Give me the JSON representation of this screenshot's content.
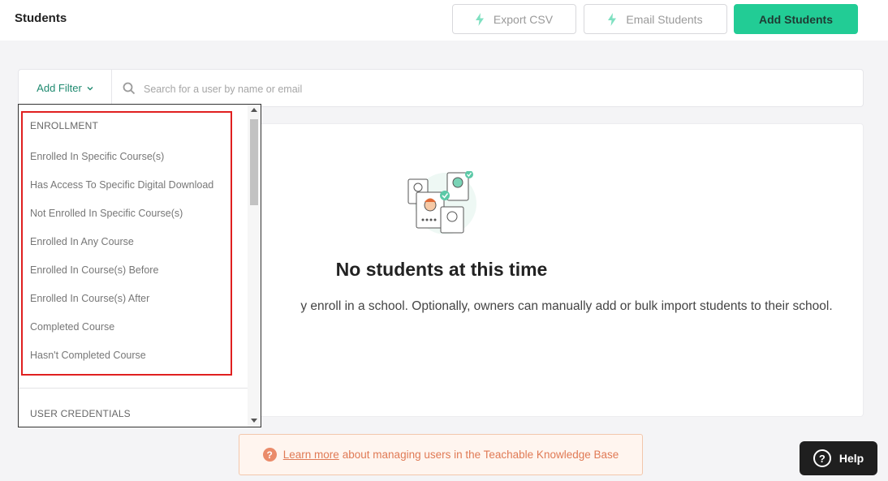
{
  "header": {
    "title": "Students",
    "export_label": "Export CSV",
    "email_label": "Email Students",
    "add_label": "Add Students"
  },
  "search": {
    "filter_label": "Add Filter",
    "placeholder": "Search for a user by name or email"
  },
  "empty_state": {
    "title": "No students at this time",
    "description": "y enroll in a school. Optionally, owners can manually add or bulk import students to their school."
  },
  "filter_menu": {
    "enrollment_header": "ENROLLMENT",
    "items": [
      "Enrolled In Specific Course(s)",
      "Has Access To Specific Digital Download",
      "Not Enrolled In Specific Course(s)",
      "Enrolled In Any Course",
      "Enrolled In Course(s) Before",
      "Enrolled In Course(s) After",
      "Completed Course",
      "Hasn't Completed Course"
    ],
    "credentials_header": "USER CREDENTIALS"
  },
  "kb_banner": {
    "icon": "question-icon",
    "link_text": "Learn more",
    "text": "about managing users in the Teachable Knowledge Base"
  },
  "help": {
    "label": "Help"
  },
  "colors": {
    "primary": "#22cc95",
    "highlight": "#e02020",
    "banner_text": "#e07a55"
  }
}
